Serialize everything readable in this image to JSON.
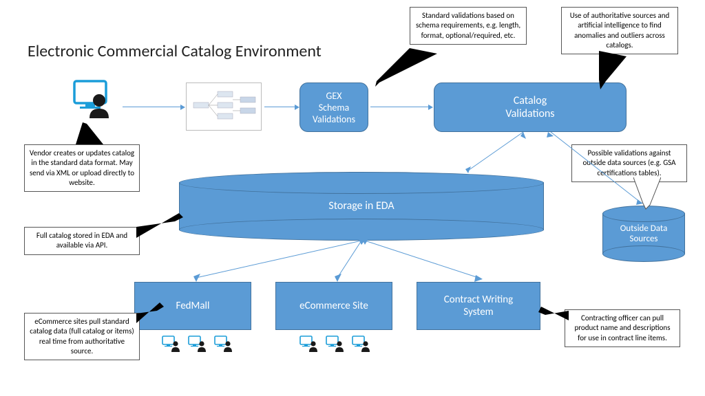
{
  "title": "Electronic Commercial Catalog Environment",
  "nodes": {
    "gex": "GEX\nSchema\nValidations",
    "catalog_val": "Catalog\nValidations",
    "storage": "Storage in EDA",
    "outside": "Outside Data\nSources",
    "fedmall": "FedMall",
    "ecommerce": "eCommerce Site",
    "cws": "Contract Writing\nSystem"
  },
  "callouts": {
    "schema": "Standard validations based on schema requirements, e.g. length, format, optional/required, etc.",
    "ai": "Use of authoritative sources and artificial intelligence to find anomalies and outliers across catalogs.",
    "vendor": "Vendor creates or updates catalog in the standard data format. May send via XML or upload directly to website.",
    "gsa": "Possible validations against outside data sources (e.g. GSA certifications tables).",
    "eda": "Full catalog stored in EDA and available via API.",
    "pull": "eCommerce sites pull standard catalog data (full catalog or items) real time from authoritative source.",
    "officer": "Contracting officer can pull product name and descriptions for use in contract line items."
  }
}
